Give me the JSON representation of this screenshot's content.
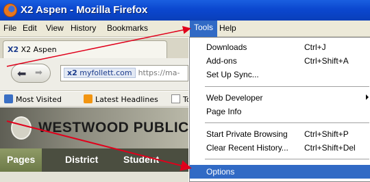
{
  "window": {
    "title": "X2 Aspen - Mozilla Firefox"
  },
  "menubar": {
    "file": "File",
    "edit": "Edit",
    "view": "View",
    "history": "History",
    "bookmarks": "Bookmarks",
    "tools": "Tools",
    "help": "Help"
  },
  "tab": {
    "icon_text": "X2",
    "title": "X2 Aspen"
  },
  "navbar": {
    "back_icon": "back-arrow-icon",
    "forward_icon": "forward-arrow-icon",
    "url_badge_icon": "x2",
    "url_domain": "myfollett.com",
    "url_rest": "https://ma-"
  },
  "bookmarks": [
    {
      "icon": "most-visited-icon",
      "label": "Most Visited"
    },
    {
      "icon": "rss-icon",
      "label": "Latest Headlines"
    },
    {
      "icon": "page-icon",
      "label": "To"
    }
  ],
  "site": {
    "school_name": "WESTWOOD PUBLIC",
    "nav": [
      "Pages",
      "District",
      "Student"
    ]
  },
  "tools_menu": {
    "downloads": {
      "label": "Downloads",
      "shortcut": "Ctrl+J"
    },
    "addons": {
      "label": "Add-ons",
      "shortcut": "Ctrl+Shift+A"
    },
    "sync": {
      "label": "Set Up Sync..."
    },
    "web_developer": {
      "label": "Web Developer"
    },
    "page_info": {
      "label": "Page Info"
    },
    "private": {
      "label": "Start Private Browsing",
      "shortcut": "Ctrl+Shift+P"
    },
    "clear_history": {
      "label": "Clear Recent History...",
      "shortcut": "Ctrl+Shift+Del"
    },
    "options": {
      "label": "Options"
    }
  },
  "colors": {
    "titlebar": "#0b47cf",
    "menu_highlight": "#316ac5",
    "annotation_arrow": "#e0001b"
  }
}
